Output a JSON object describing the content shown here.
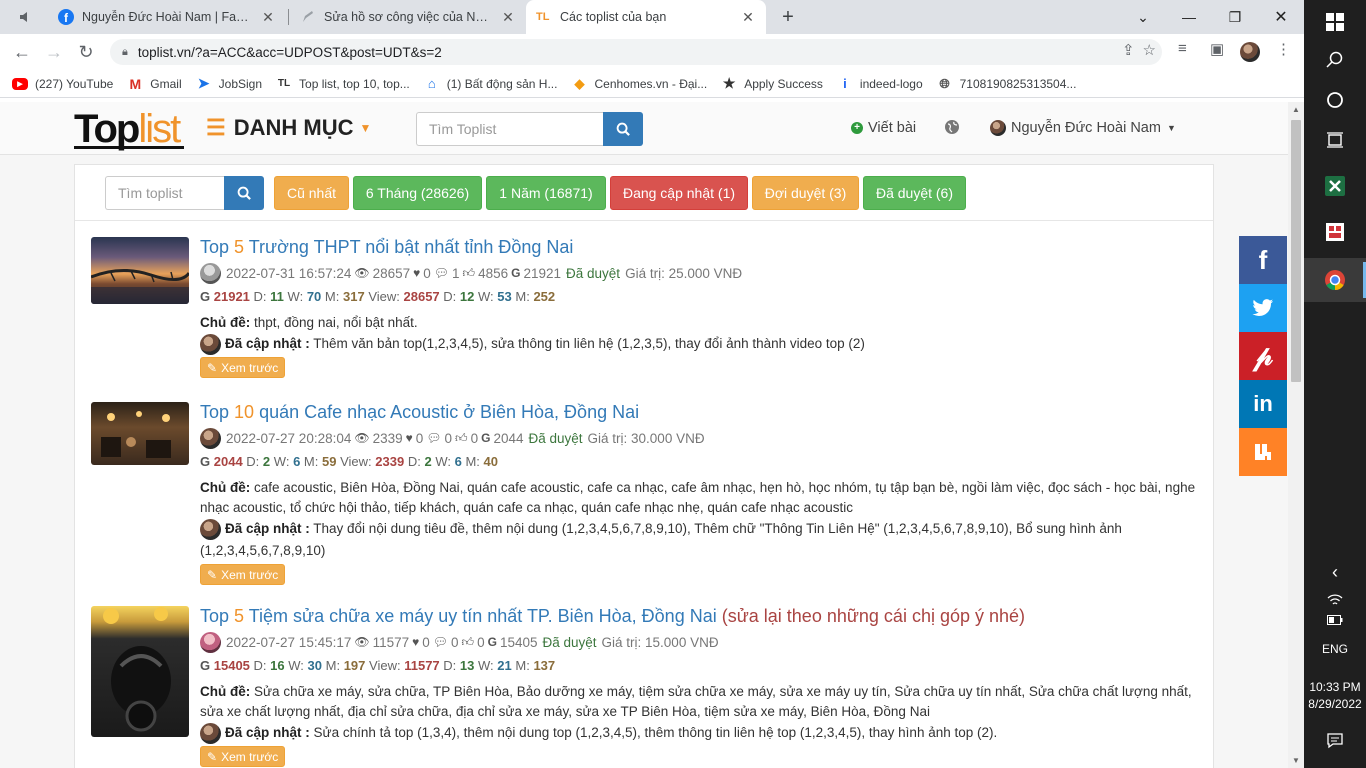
{
  "browser": {
    "tabs": [
      {
        "title": "Nguyễn Đức Hoài Nam | Facebook"
      },
      {
        "title": "Sửa hồ sơ công việc của Nguyễn"
      },
      {
        "title": "Các toplist của bạn"
      }
    ],
    "tab3_favicon": "TL",
    "url": "toplist.vn/?a=ACC&acc=UDPOST&post=UDT&s=2",
    "bookmarks": [
      {
        "label": "(227) YouTube",
        "icon": "youtube-icon"
      },
      {
        "label": "Gmail",
        "icon": "gmail-icon"
      },
      {
        "label": "JobSign",
        "icon": "jobsign-icon"
      },
      {
        "label": "Top list, top 10, top...",
        "icon": "toplist-icon"
      },
      {
        "label": "(1) Bất động sản H...",
        "icon": "house-icon"
      },
      {
        "label": "Cenhomes.vn - Đại...",
        "icon": "cenhomes-icon"
      },
      {
        "label": "Apply Success",
        "icon": "star-icon"
      },
      {
        "label": "indeed-logo",
        "icon": "indeed-icon"
      },
      {
        "label": "7108190825313504...",
        "icon": "globe-icon"
      }
    ],
    "bookmark_fav_tl": "TL"
  },
  "site": {
    "logo_top": "Top",
    "logo_list": "list",
    "menu_label": "DANH MỤC",
    "search_placeholder": "Tìm Toplist",
    "write_label": "Viết bài",
    "user_name": "Nguyễn Đức Hoài Nam"
  },
  "filters": {
    "search_placeholder": "Tìm toplist",
    "buttons": [
      {
        "label": "Cũ nhất",
        "color": "#f0ad4e"
      },
      {
        "label": "6 Tháng (28626)",
        "color": "#5cb85c"
      },
      {
        "label": "1 Năm (16871)",
        "color": "#5cb85c"
      },
      {
        "label": "Đang cập nhật (1)",
        "color": "#d9534f"
      },
      {
        "label": "Đợi duyệt (3)",
        "color": "#f0ad4e"
      },
      {
        "label": "Đã duyệt (6)",
        "color": "#5cb85c"
      }
    ]
  },
  "posts": [
    {
      "title_prefix": "Top ",
      "title_num": "5",
      "title_text": " Trường THPT nổi bật nhất tỉnh Đồng Nai",
      "title_note": "",
      "datetime": "2022-07-31 16:57:24",
      "views": "28657",
      "likes": "0",
      "comments": "1",
      "thumbs": "4856",
      "g": "21921",
      "status": "Đã duyệt",
      "value": "Giá trị: 25.000 VNĐ",
      "stats": {
        "g": "21921",
        "d": "11",
        "w": "70",
        "m": "317",
        "view": "28657",
        "d2": "12",
        "w2": "53",
        "m2": "252"
      },
      "topic_label": "Chủ đề:",
      "topic": "thpt, đồng nai, nổi bật nhất.",
      "update_label": "Đã cập nhật :",
      "update": "Thêm văn bản top(1,2,3,4,5), sửa thông tin liên hệ (1,2,3,5), thay đổi ảnh thành video top (2)",
      "preview": "Xem trước"
    },
    {
      "title_prefix": "Top ",
      "title_num": "10",
      "title_text": " quán Cafe nhạc Acoustic ở Biên Hòa, Đồng Nai",
      "title_note": "",
      "datetime": "2022-07-27 20:28:04",
      "views": "2339",
      "likes": "0",
      "comments": "0",
      "thumbs": "0",
      "g": "2044",
      "status": "Đã duyệt",
      "value": "Giá trị: 30.000 VNĐ",
      "stats": {
        "g": "2044",
        "d": "2",
        "w": "6",
        "m": "59",
        "view": "2339",
        "d2": "2",
        "w2": "6",
        "m2": "40"
      },
      "topic_label": "Chủ đề:",
      "topic": "cafe acoustic, Biên Hòa, Đồng Nai, quán cafe acoustic, cafe ca nhạc, cafe âm nhạc, hẹn hò, học nhóm, tụ tập bạn bè, ngồi làm việc, đọc sách - học bài, nghe nhạc acoustic, tổ chức hội thảo, tiếp khách, quán cafe ca nhạc, quán cafe nhạc nhẹ, quán cafe nhạc acoustic",
      "update_label": "Đã cập nhật :",
      "update": "Thay đổi nội dung tiêu đề, thêm nội dung (1,2,3,4,5,6,7,8,9,10), Thêm chữ \"Thông Tin Liên Hệ\" (1,2,3,4,5,6,7,8,9,10), Bổ sung hình ảnh (1,2,3,4,5,6,7,8,9,10)",
      "preview": "Xem trước"
    },
    {
      "title_prefix": "Top ",
      "title_num": "5",
      "title_text": " Tiệm sửa chữa xe máy uy tín nhất TP. Biên Hòa, Đồng Nai",
      "title_note": "(sửa lại theo những cái chị góp ý nhé)",
      "datetime": "2022-07-27 15:45:17",
      "views": "11577",
      "likes": "0",
      "comments": "0",
      "thumbs": "0",
      "g": "15405",
      "status": "Đã duyệt",
      "value": "Giá trị: 15.000 VNĐ",
      "stats": {
        "g": "15405",
        "d": "16",
        "w": "30",
        "m": "197",
        "view": "11577",
        "d2": "13",
        "w2": "21",
        "m2": "137"
      },
      "topic_label": "Chủ đề:",
      "topic": "Sửa chữa xe máy, sửa chữa, TP Biên Hòa, Bảo dưỡng xe máy, tiệm sửa chữa xe máy, sửa xe máy uy tín, Sửa chữa uy tín nhất, Sửa chữa chất lượng nhất, sửa xe chất lượng nhất, địa chỉ sửa chữa, địa chỉ sửa xe máy, sửa xe TP Biên Hòa, tiệm sửa xe máy, Biên Hòa, Đồng Nai",
      "update_label": "Đã cập nhật :",
      "update": "Sửa chính tả top (1,3,4), thêm nội dung top (1,2,3,4,5), thêm thông tin liên hệ top (1,2,3,4,5), thay hình ảnh top (2).",
      "preview": "Xem trước"
    }
  ],
  "stat_labels": {
    "d": "D:",
    "w": "W:",
    "m": "M:",
    "view": "View:"
  },
  "social": [
    {
      "name": "facebook",
      "color": "#3b5998",
      "glyph": "f"
    },
    {
      "name": "twitter",
      "color": "#1da1f2",
      "glyph": "t"
    },
    {
      "name": "pinterest",
      "color": "#cb2027",
      "glyph": "p"
    },
    {
      "name": "linkedin",
      "color": "#0077b5",
      "glyph": "in"
    },
    {
      "name": "mix",
      "color": "#ff8226",
      "glyph": "m"
    }
  ],
  "taskbar": {
    "lang": "ENG",
    "time": "10:33 PM",
    "date": "8/29/2022"
  }
}
